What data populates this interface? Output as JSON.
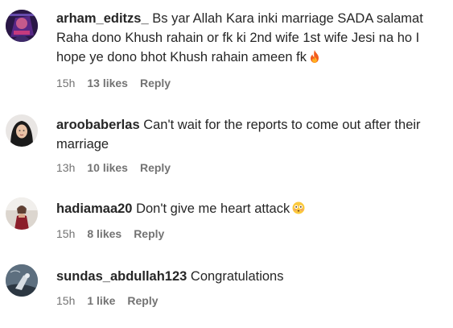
{
  "comments": [
    {
      "username": "arham_editzs_",
      "text": "Bs yar Allah Kara inki marriage SADA salamat Raha dono Khush rahain or fk ki 2nd wife 1st wife Jesi na ho I hope ye dono bhot Khush rahain ameen fk",
      "emoji": "fire-emoji",
      "time": "15h",
      "likes": "13 likes",
      "reply": "Reply"
    },
    {
      "username": "aroobaberlas",
      "text": "Can't wait for the reports to come out after their marriage",
      "time": "13h",
      "likes": "10 likes",
      "reply": "Reply"
    },
    {
      "username": "hadiamaa20",
      "text": "Don't give me heart attack",
      "emoji": "flushed-face-emoji",
      "time": "15h",
      "likes": "8 likes",
      "reply": "Reply"
    },
    {
      "username": "sundas_abdullah123",
      "text": "Congratulations",
      "time": "15h",
      "likes": "1 like",
      "reply": "Reply"
    }
  ],
  "colors": {
    "text": "#262626",
    "meta": "#737373",
    "background": "#ffffff"
  }
}
